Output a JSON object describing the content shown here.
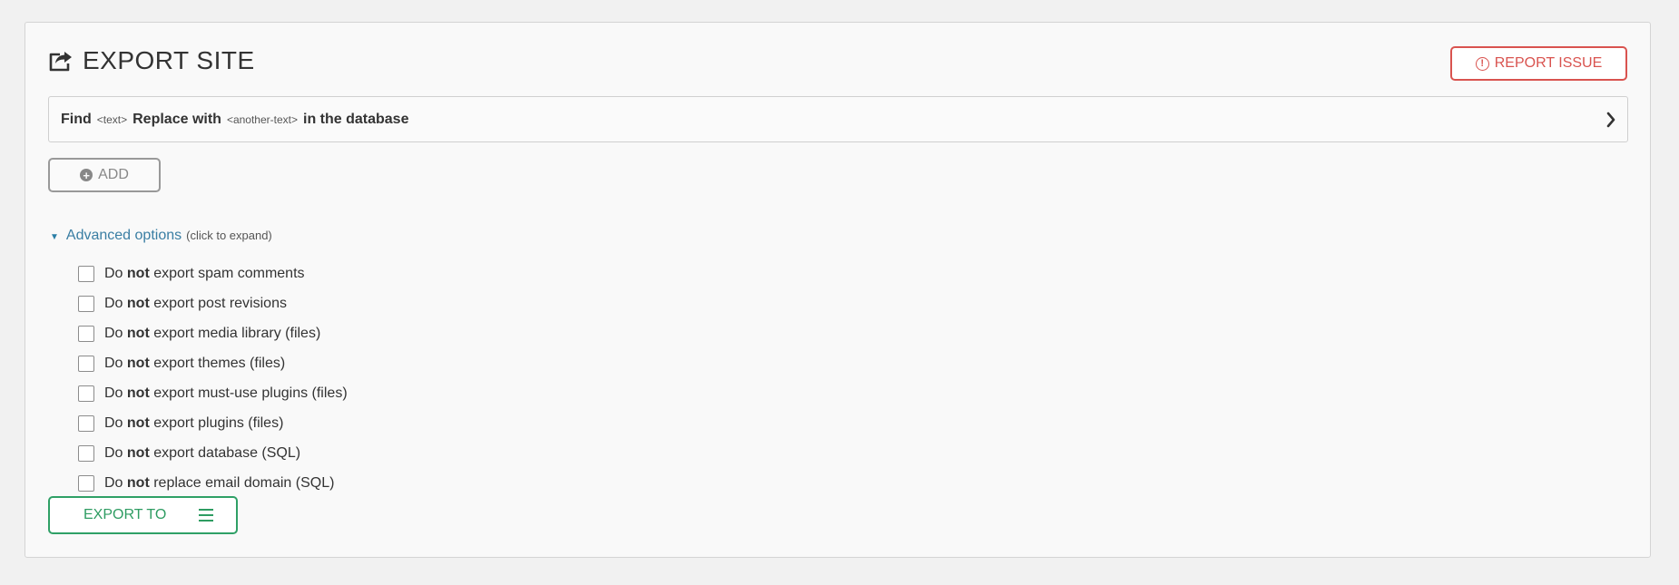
{
  "header": {
    "title": "EXPORT SITE",
    "report_button": "REPORT ISSUE",
    "report_icon_glyph": "!"
  },
  "find_replace": {
    "find": "Find",
    "find_placeholder": "<text>",
    "replace_with": "Replace with",
    "replace_placeholder": "<another-text>",
    "suffix": "in the database"
  },
  "add_button": {
    "label": "ADD",
    "icon_glyph": "+"
  },
  "advanced": {
    "label": "Advanced options",
    "hint": "(click to expand)",
    "toggle_glyph": "▼",
    "options": [
      {
        "prefix": "Do ",
        "emphasis": "not",
        "rest": " export spam comments",
        "checked": false
      },
      {
        "prefix": "Do ",
        "emphasis": "not",
        "rest": " export post revisions",
        "checked": false
      },
      {
        "prefix": "Do ",
        "emphasis": "not",
        "rest": " export media library (files)",
        "checked": false
      },
      {
        "prefix": "Do ",
        "emphasis": "not",
        "rest": " export themes (files)",
        "checked": false
      },
      {
        "prefix": "Do ",
        "emphasis": "not",
        "rest": " export must-use plugins (files)",
        "checked": false
      },
      {
        "prefix": "Do ",
        "emphasis": "not",
        "rest": " export plugins (files)",
        "checked": false
      },
      {
        "prefix": "Do ",
        "emphasis": "not",
        "rest": " export database (SQL)",
        "checked": false
      },
      {
        "prefix": "Do ",
        "emphasis": "not",
        "rest": " replace email domain (SQL)",
        "checked": false
      }
    ]
  },
  "export_button": {
    "label": "EXPORT TO"
  },
  "icons": {
    "title": "share-export-icon",
    "report": "alert-circle-icon",
    "find_replace": "chevron-right-icon",
    "add": "plus-circle-icon",
    "export": "menu-icon"
  },
  "colors": {
    "danger": "#d9534f",
    "success": "#2fa066",
    "link": "#3a7ea3",
    "neutral_button": "#999999"
  }
}
